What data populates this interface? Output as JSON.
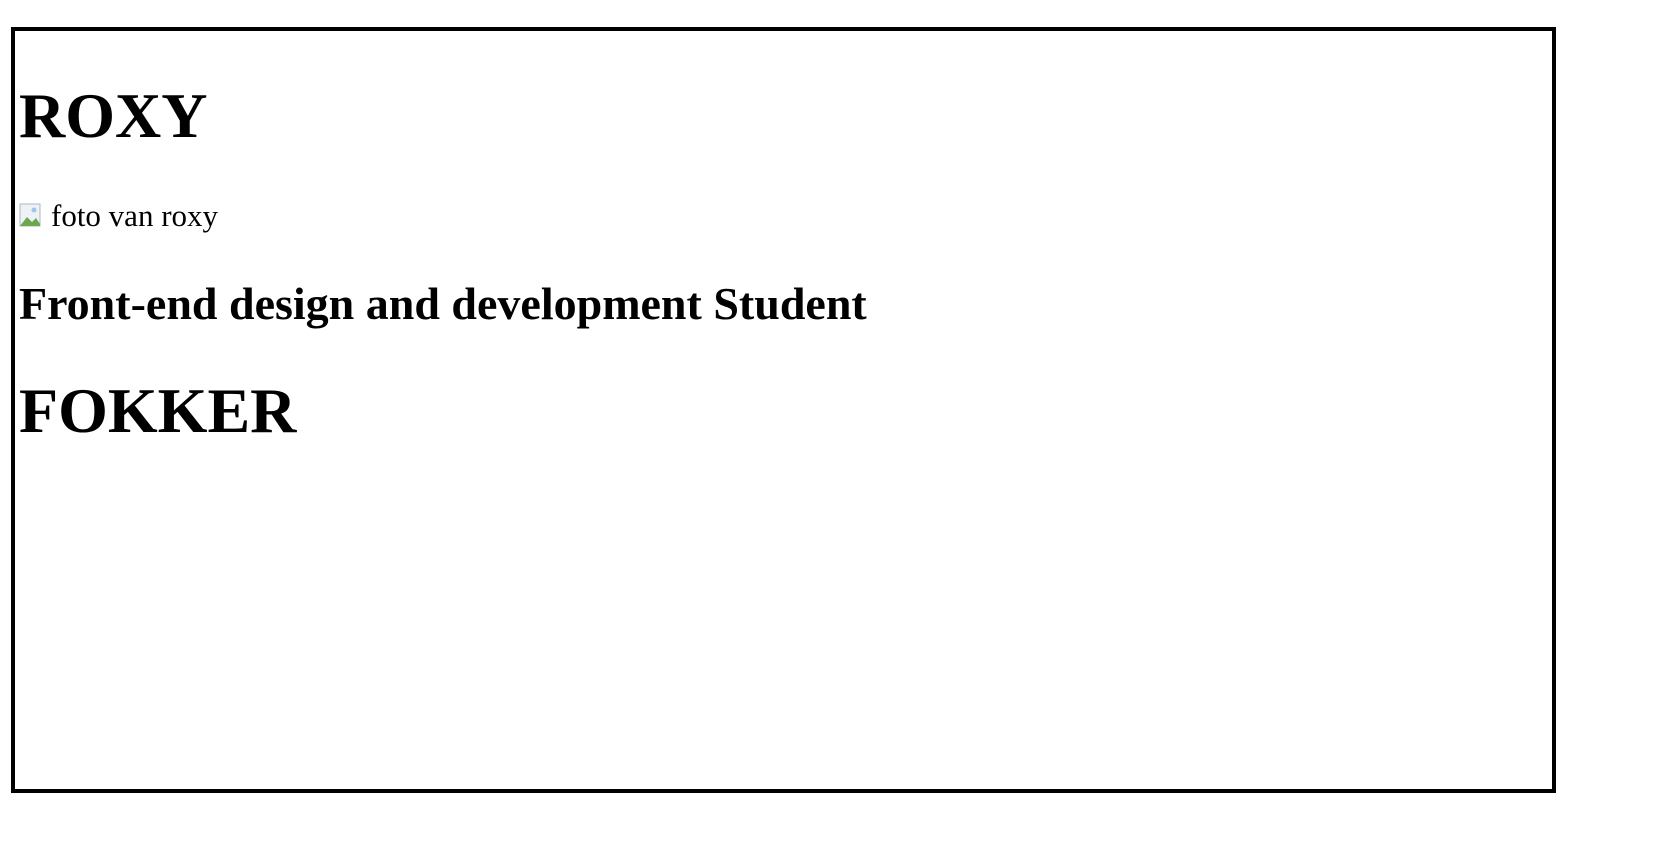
{
  "header": {
    "first_name": "ROXY",
    "role": "Front-end design and development Student",
    "last_name": "FOKKER"
  },
  "photo": {
    "alt_text": "foto van roxy",
    "icon": "broken-image-icon"
  }
}
